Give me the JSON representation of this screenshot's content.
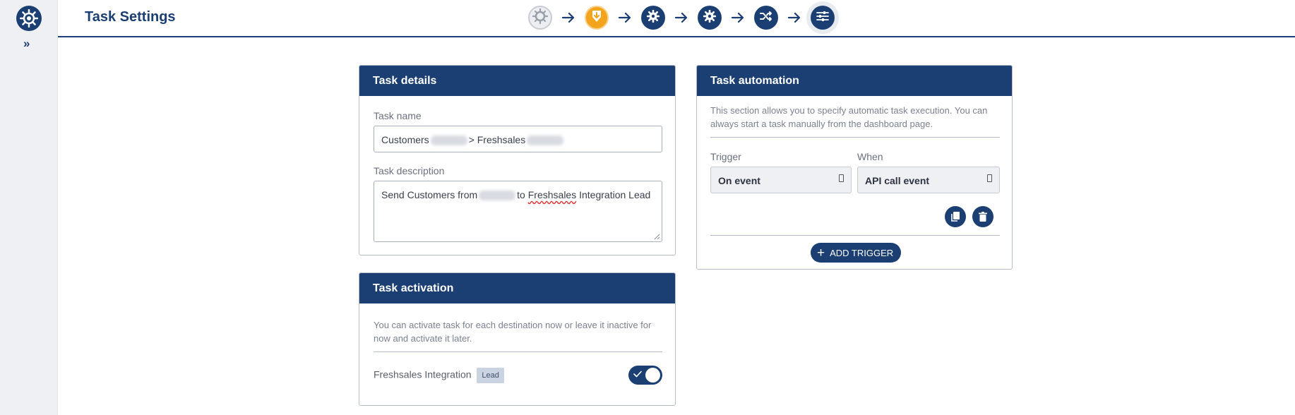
{
  "app": {
    "title": "Task Settings"
  },
  "sidebar": {
    "expand_label": "»"
  },
  "stepper": {
    "steps": [
      {
        "icon": "source-app-icon",
        "state": "done"
      },
      {
        "icon": "download-icon",
        "state": "warning"
      },
      {
        "icon": "gear-icon",
        "state": "done"
      },
      {
        "icon": "gear-icon",
        "state": "done"
      },
      {
        "icon": "shuffle-icon",
        "state": "done"
      },
      {
        "icon": "sliders-icon",
        "state": "active"
      }
    ]
  },
  "task_details": {
    "header": "Task details",
    "name_label": "Task name",
    "name_part1": "Customers",
    "name_part2": "> Freshsales",
    "description_label": "Task description",
    "desc_part1": "Send Customers from",
    "desc_part2": "to",
    "desc_part3": "Freshsales",
    "desc_part4": "Integration Lead"
  },
  "task_activation": {
    "header": "Task activation",
    "help": "You can activate task for each destination now or leave it inactive for now and activate it later.",
    "destination_label": "Freshsales Integration",
    "destination_badge": "Lead",
    "enabled": true
  },
  "task_automation": {
    "header": "Task automation",
    "help": "This section allows you to specify automatic task execution. You can always start a task manually from the dashboard page.",
    "trigger_label": "Trigger",
    "when_label": "When",
    "trigger_value": "On event",
    "when_value": "API call event",
    "add_trigger_label": "ADD TRIGGER"
  },
  "colors": {
    "primary": "#1c3f73",
    "warning": "#f4a31c",
    "sidebar": "#eef0f4"
  }
}
